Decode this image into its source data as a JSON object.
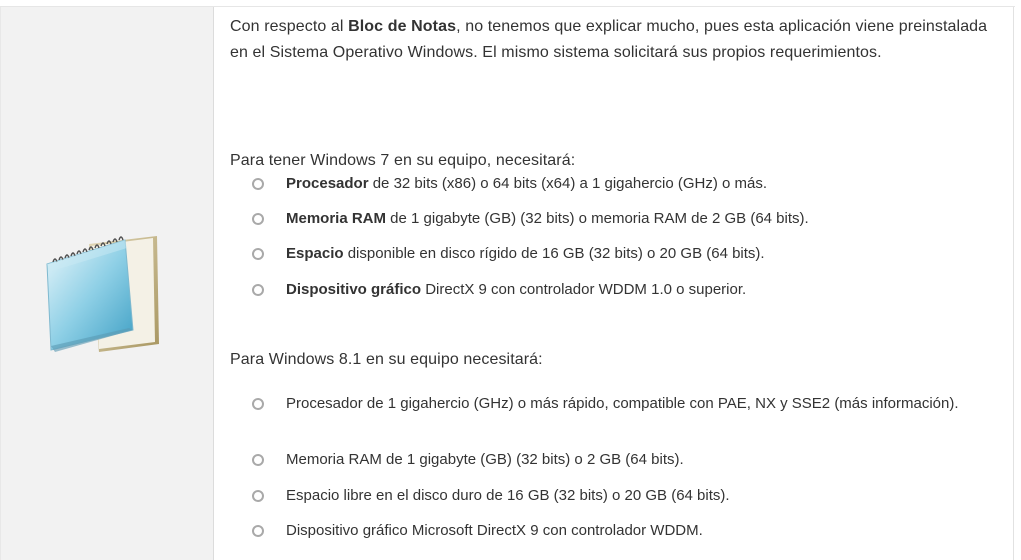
{
  "intro": {
    "before": "Con respecto al ",
    "bold": "Bloc de Notas",
    "after": ", no tenemos que explicar mucho, pues esta aplicación viene preinstalada en el Sistema Operativo Windows. El mismo sistema solicitará sus propios requerimientos."
  },
  "win7": {
    "heading": "Para tener Windows 7 en su equipo, necesitará:",
    "items": [
      {
        "lead": "Procesador",
        "rest": " de 32 bits (x86) o 64 bits (x64) a 1 gigahercio (GHz) o más."
      },
      {
        "lead": "Memoria RAM",
        "rest": " de 1 gigabyte (GB) (32 bits) o memoria RAM de 2 GB (64 bits)."
      },
      {
        "lead": "Espacio",
        "rest": " disponible en disco rígido de 16 GB (32 bits) o 20 GB (64 bits)."
      },
      {
        "lead": "Dispositivo gráfico",
        "rest": " DirectX 9 con controlador WDDM 1.0 o superior."
      }
    ]
  },
  "win81": {
    "heading": "Para Windows 8.1 en su equipo necesitará:",
    "items": [
      "Procesador de 1 gigahercio (GHz) o más rápido, compatible con PAE, NX y SSE2 (más información).",
      "Memoria RAM de 1 gigabyte (GB) (32 bits) o 2 GB (64 bits).",
      "Espacio libre en el disco duro de 16 GB (32 bits) o 20 GB (64 bits).",
      "Dispositivo gráfico Microsoft DirectX 9 con controlador WDDM."
    ]
  },
  "icon": "notepad-icon"
}
